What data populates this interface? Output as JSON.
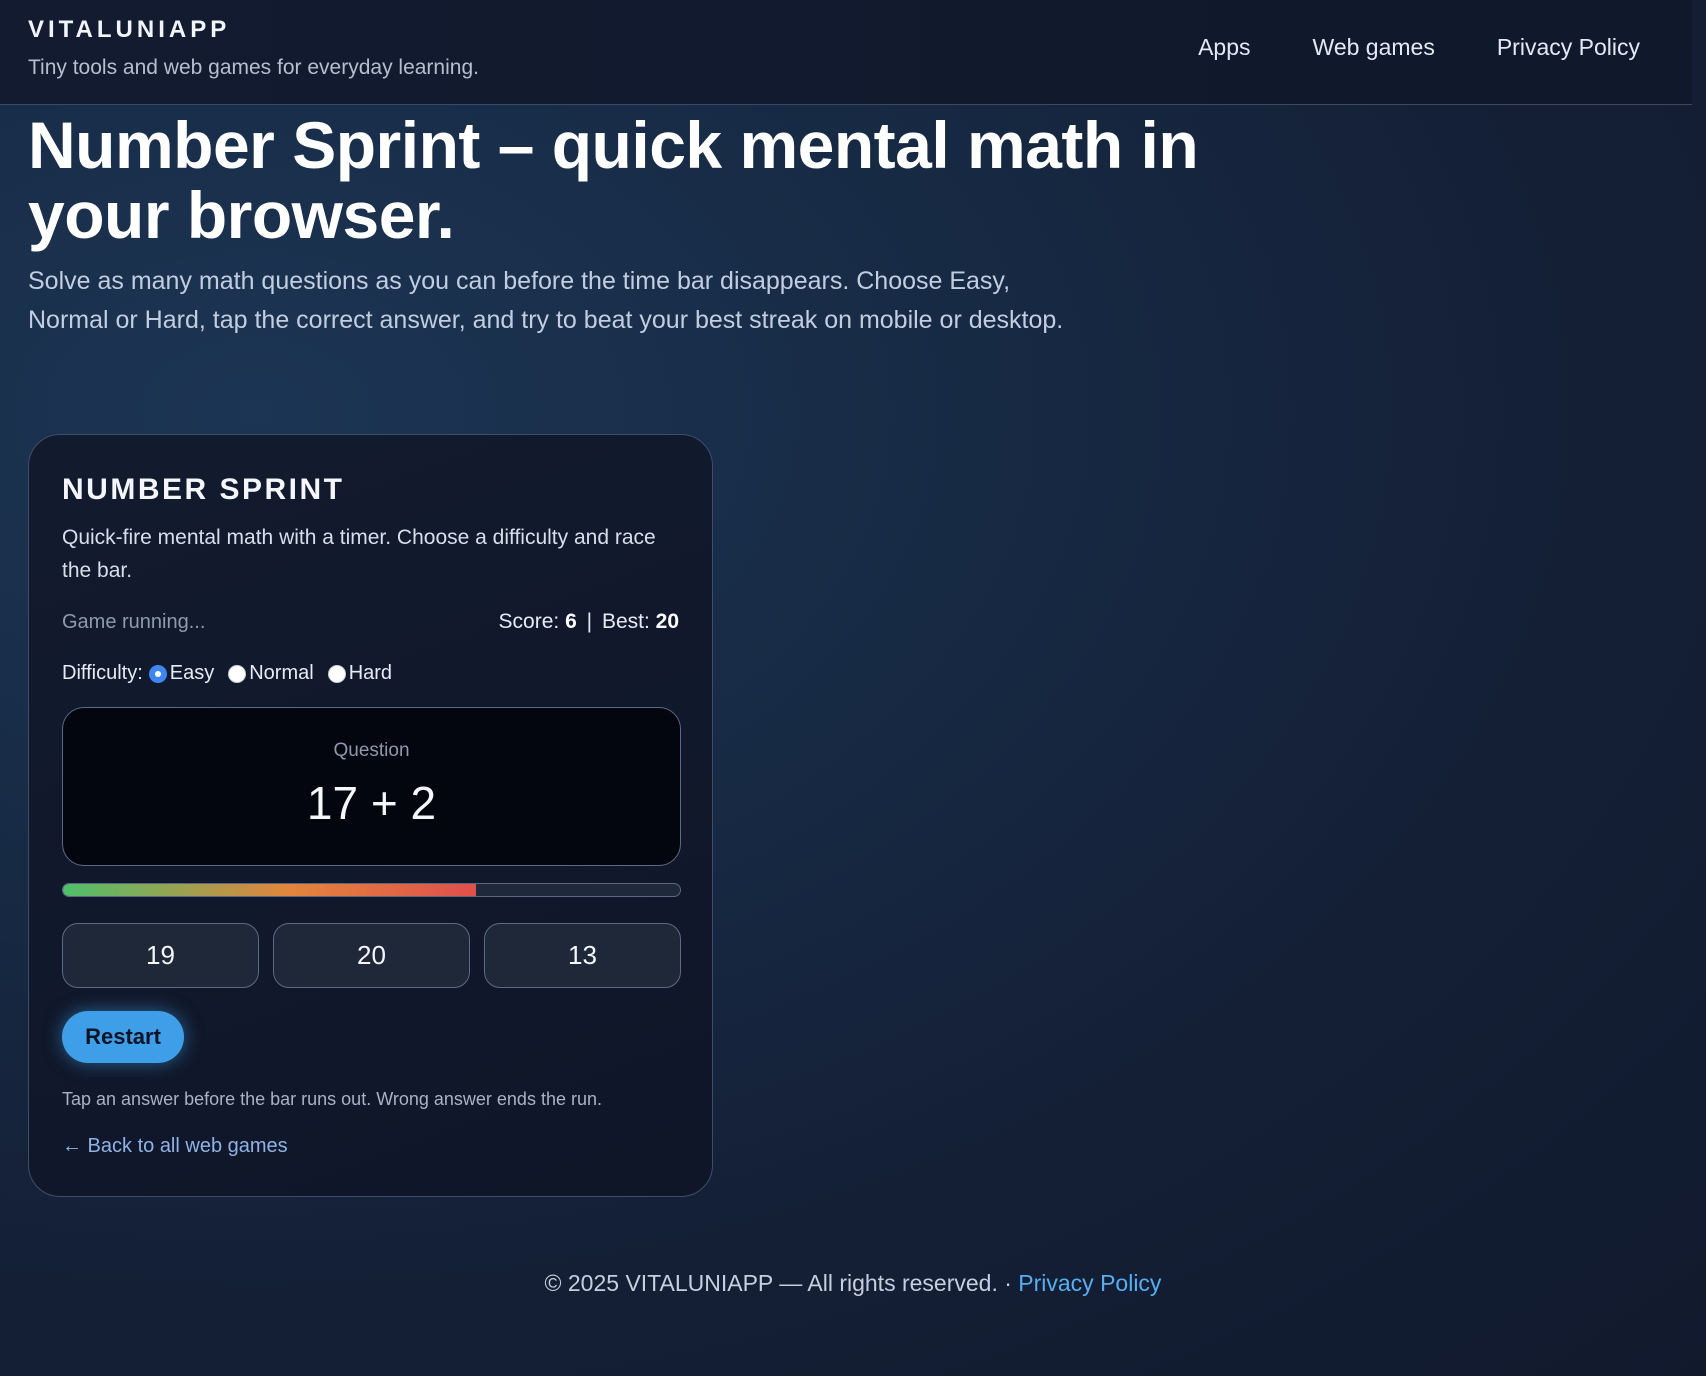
{
  "header": {
    "brand": "VITALUNIAPP",
    "tagline": "Tiny tools and web games for everyday learning.",
    "nav": [
      {
        "label": "Apps"
      },
      {
        "label": "Web games"
      },
      {
        "label": "Privacy Policy"
      }
    ]
  },
  "hero": {
    "title": "Number Sprint – quick mental math in your browser.",
    "description": "Solve as many math questions as you can before the time bar disappears. Choose Easy, Normal or Hard, tap the correct answer, and try to beat your best streak on mobile or desktop."
  },
  "game": {
    "title": "NUMBER SPRINT",
    "description": "Quick-fire mental math with a timer. Choose a difficulty and race the bar.",
    "status": "Game running...",
    "score_label": "Score:",
    "score": "6",
    "separator": "|",
    "best_label": "Best:",
    "best": "20",
    "difficulty_label": "Difficulty:",
    "difficulties": [
      {
        "label": "Easy",
        "selected": true
      },
      {
        "label": "Normal",
        "selected": false
      },
      {
        "label": "Hard",
        "selected": false
      }
    ],
    "question_label": "Question",
    "question": "17 + 2",
    "timer_remaining_fraction": 0.67,
    "answers": [
      "19",
      "20",
      "13"
    ],
    "restart_label": "Restart",
    "hint": "Tap an answer before the bar runs out. Wrong answer ends the run.",
    "back_link": "← Back to all web games"
  },
  "footer": {
    "copyright": "© 2025 VITALUNIAPP — All rights reserved. ·",
    "privacy_link": "Privacy Policy"
  },
  "colors": {
    "accent": "#3f9ee8",
    "link": "#57aef0",
    "radio_selected": "#3f86f2",
    "timer_start": "#4fc06a",
    "timer_mid": "#e2853c",
    "timer_end": "#e04f4c"
  }
}
